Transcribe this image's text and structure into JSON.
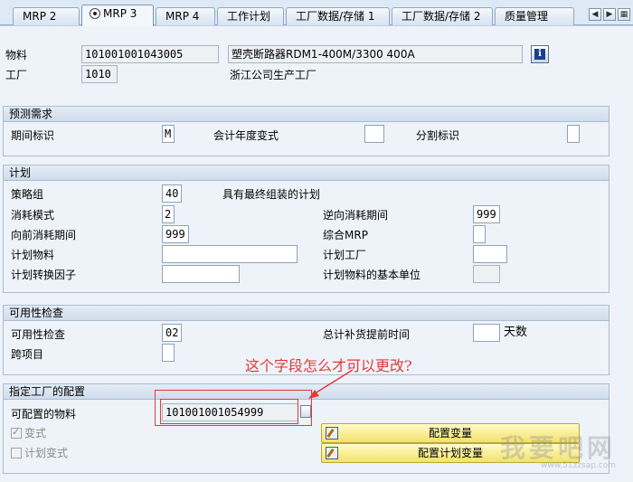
{
  "tabs": [
    {
      "label": "MRP 2",
      "active": false
    },
    {
      "label": "MRP 3",
      "active": true
    },
    {
      "label": "MRP 4",
      "active": false
    },
    {
      "label": "工作计划",
      "active": false
    },
    {
      "label": "工厂数据/存储 1",
      "active": false
    },
    {
      "label": "工厂数据/存储 2",
      "active": false
    },
    {
      "label": "质量管理",
      "active": false
    }
  ],
  "nav": {
    "prev": "◀",
    "next": "▶",
    "menu": "▦"
  },
  "header": {
    "material_label": "物料",
    "material_value": "101001001043005",
    "material_desc": "塑壳断路器RDM1-400M/3300 400A",
    "plant_label": "工厂",
    "plant_value": "1010",
    "plant_desc": "浙江公司生产工厂",
    "info_icon": "i"
  },
  "forecast": {
    "title": "预测需求",
    "period_label": "期间标识",
    "period_value": "M",
    "fiscal_label": "会计年度变式",
    "fiscal_value": "",
    "split_label": "分割标识",
    "split_value": ""
  },
  "planning": {
    "title": "计划",
    "strategy_label": "策略组",
    "strategy_value": "40",
    "strategy_desc": "具有最终组装的计划",
    "consumption_label": "消耗模式",
    "consumption_value": "2",
    "backward_label": "逆向消耗期间",
    "backward_value": "999",
    "forward_label": "向前消耗期间",
    "forward_value": "999",
    "mixed_mrp_label": "综合MRP",
    "mixed_mrp_value": "",
    "plan_material_label": "计划物料",
    "plan_material_value": "",
    "plan_plant_label": "计划工厂",
    "plan_plant_value": "",
    "conv_factor_label": "计划转换因子",
    "conv_factor_value": "",
    "base_unit_label": "计划物料的基本单位",
    "base_unit_value": ""
  },
  "availability": {
    "title": "可用性检查",
    "check_label": "可用性检查",
    "check_value": "02",
    "leadtime_label": "总计补货提前时间",
    "leadtime_value": "",
    "leadtime_unit": "天数",
    "cross_project_label": "跨项目",
    "cross_project_value": ""
  },
  "config": {
    "title": "指定工厂的配置",
    "configurable_label": "可配置的物料",
    "configurable_value": "101001001054999",
    "variant_label": "变式",
    "variant_checked": true,
    "plan_variant_label": "计划变式",
    "plan_variant_checked": false,
    "config_variant_button": "配置变量",
    "config_plan_variant_button": "配置计划变量"
  },
  "annotation": {
    "text": "这个字段怎么才可以更改?",
    "color": "#e23a3a"
  },
  "watermark": {
    "text": "我要吧网",
    "url": "www.51zzsap.com"
  },
  "colors": {
    "accent": "#8fa9c8",
    "button": "#f3e26a",
    "annotation": "#e23a3a"
  }
}
